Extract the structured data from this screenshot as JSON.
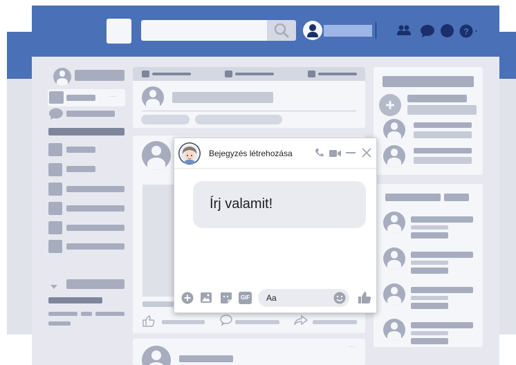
{
  "colors": {
    "topbar": "#4a70b8",
    "page_bg": "#e7e8ef",
    "card": "#f5f6fa",
    "placeholder": "#a7adbf",
    "accent_blue": "#1a2f6b",
    "chat_icon_gray": "#9ea3b0"
  },
  "chat": {
    "title": "Bejegyzés létrehozása",
    "message": "Írj valamit!",
    "input_placeholder": "Aa",
    "gif_label": "GIF"
  },
  "icons": {
    "search": "search-icon",
    "friends": "friends-icon",
    "messenger": "messenger-icon",
    "notifications": "notifications-icon",
    "help": "help-icon",
    "phone": "phone-icon",
    "video": "video-icon",
    "minimize": "minimize-icon",
    "close": "close-icon",
    "like": "like-icon",
    "comment": "comment-icon",
    "share": "share-icon"
  }
}
